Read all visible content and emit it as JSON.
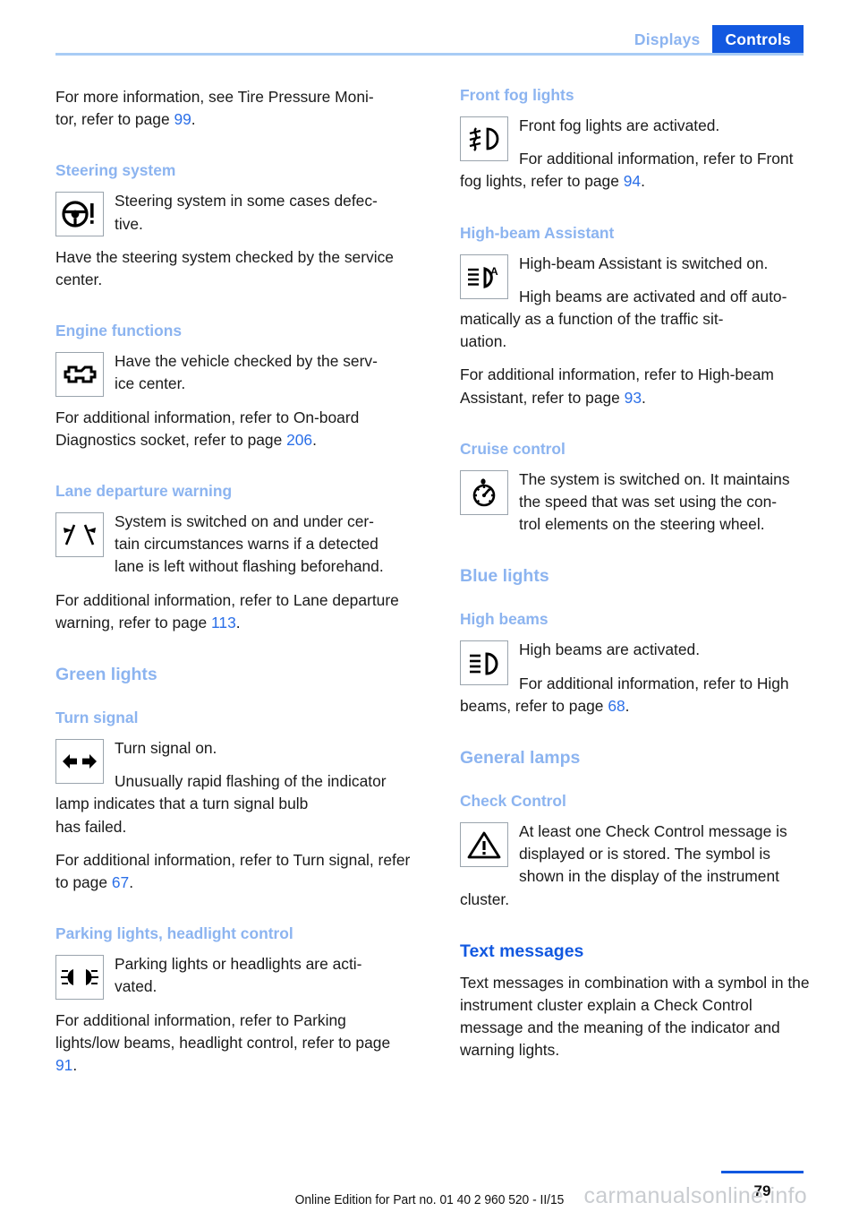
{
  "header": {
    "tab_inactive": "Displays",
    "tab_active": "Controls",
    "accent_light": "#8cb4f0",
    "accent_strong": "#1258e0"
  },
  "left_column": {
    "intro": {
      "text_a": "For more information, see Tire Pressure Moni-",
      "text_b": "tor, refer to page ",
      "page": "99",
      "text_c": "."
    },
    "sections": [
      {
        "heading": "Steering system",
        "icon": "steering-wheel-warning-icon",
        "lines": [
          "Steering system in some cases defec-",
          "tive."
        ],
        "para2": "Have the steering system checked by the service center."
      },
      {
        "heading": "Engine functions",
        "icon": "engine-check-icon",
        "lines": [
          "Have the vehicle checked by the serv-",
          "ice center."
        ],
        "para2_a": "For additional information, refer to On-board Diagnostics socket, refer to page ",
        "para2_page": "206",
        "para2_b": "."
      },
      {
        "heading": "Lane departure warning",
        "icon": "lane-departure-icon",
        "lines": [
          "System is switched on and under cer-",
          "tain circumstances warns if a detected",
          "lane is left without flashing beforehand."
        ],
        "para2_a": "For additional information, refer to Lane departure warning, refer to page ",
        "para2_page": "113",
        "para2_b": "."
      }
    ],
    "green_lights_heading": "Green lights",
    "green_sections": [
      {
        "heading": "Turn signal",
        "icon": "turn-signal-icon",
        "lines": [
          "Turn signal on."
        ],
        "lines2": [
          "Unusually rapid flashing of the indicator",
          "lamp indicates that a turn signal bulb"
        ],
        "tail": "has failed.",
        "para3_a": "For additional information, refer to Turn signal, refer to page ",
        "para3_page": "67",
        "para3_b": "."
      },
      {
        "heading": "Parking lights, headlight control",
        "icon": "parking-lights-icon",
        "lines": [
          "Parking lights or headlights are acti-",
          "vated."
        ],
        "para2_a": "For additional information, refer to Parking lights/low beams, headlight control, refer to page ",
        "para2_page": "91",
        "para2_b": "."
      }
    ]
  },
  "right_column": {
    "sections": [
      {
        "heading": "Front fog lights",
        "icon": "front-fog-lights-icon",
        "lines": [
          "Front fog lights are activated."
        ],
        "lines2_a": "For additional information, refer to Front fog lights, refer to page ",
        "lines2_page": "94",
        "lines2_b": "."
      },
      {
        "heading": "High-beam Assistant",
        "icon": "high-beam-assistant-icon",
        "lines": [
          "High-beam Assistant is switched on."
        ],
        "lines2": [
          "High beams are activated and off auto-",
          "matically as a function of the traffic sit-"
        ],
        "tail": "uation.",
        "para3_a": "For additional information, refer to High-beam Assistant, refer to page ",
        "para3_page": "93",
        "para3_b": "."
      },
      {
        "heading": "Cruise control",
        "icon": "cruise-control-icon",
        "lines": [
          "The system is switched on. It maintains",
          "the speed that was set using the con-",
          "trol elements on the steering wheel."
        ]
      }
    ],
    "blue_lights_heading": "Blue lights",
    "blue_sections": [
      {
        "heading": "High beams",
        "icon": "high-beams-icon",
        "lines": [
          "High beams are activated."
        ],
        "lines2_a": "For additional information, refer to High beams, refer to page ",
        "lines2_page": "68",
        "lines2_b": "."
      }
    ],
    "general_lamps_heading": "General lamps",
    "general_sections": [
      {
        "heading": "Check Control",
        "icon": "warning-triangle-icon",
        "lines": [
          "At least one Check Control message is",
          "displayed or is stored. The symbol is",
          "shown in the display of the instrument"
        ],
        "tail": "cluster."
      }
    ],
    "text_messages_heading": "Text messages",
    "text_messages_body": "Text messages in combination with a symbol in the instrument cluster explain a Check Control message and the meaning of the indicator and warning lights."
  },
  "footer": {
    "edition": "Online Edition for Part no. 01 40 2 960 520 - II/15",
    "page_number": "79",
    "watermark": "carmanualsonline.info"
  }
}
